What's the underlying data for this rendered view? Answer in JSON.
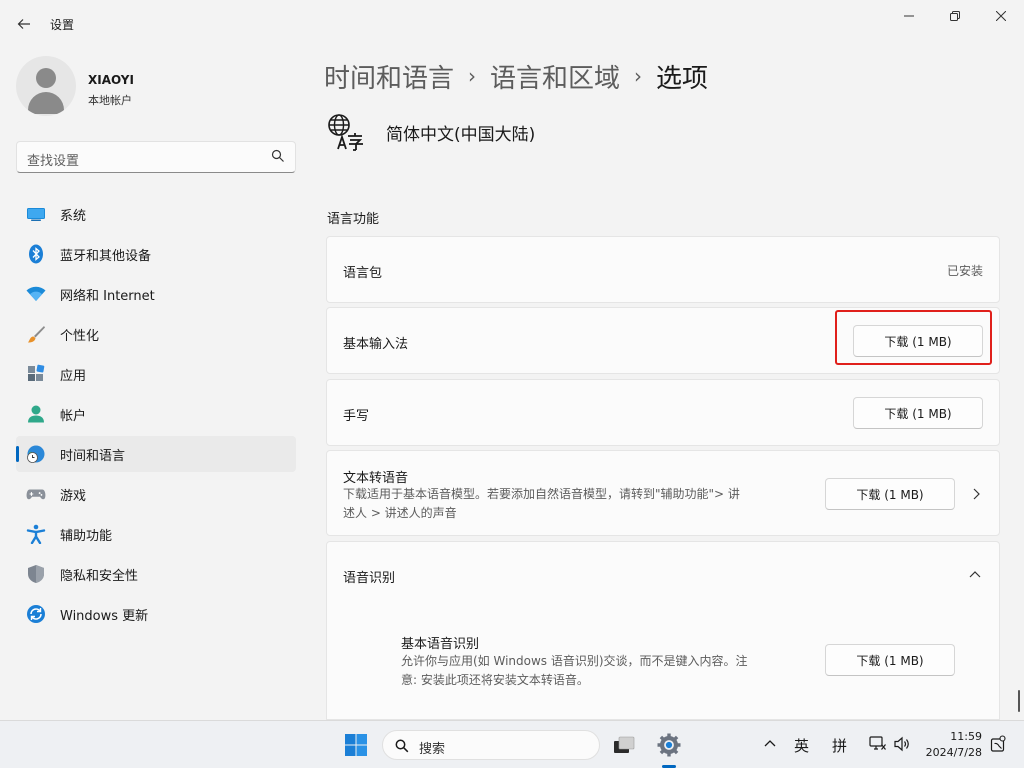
{
  "window": {
    "title": "设置",
    "controls": [
      "minimize",
      "maximize",
      "close"
    ]
  },
  "user": {
    "name": "XIAOYI",
    "account_type": "本地帐户"
  },
  "search": {
    "placeholder": "查找设置"
  },
  "sidebar": {
    "items": [
      {
        "label": "系统",
        "icon": "system-icon",
        "active": false
      },
      {
        "label": "蓝牙和其他设备",
        "icon": "bluetooth-icon",
        "active": false
      },
      {
        "label": "网络和 Internet",
        "icon": "wifi-icon",
        "active": false
      },
      {
        "label": "个性化",
        "icon": "brush-icon",
        "active": false
      },
      {
        "label": "应用",
        "icon": "apps-icon",
        "active": false
      },
      {
        "label": "帐户",
        "icon": "person-icon",
        "active": false
      },
      {
        "label": "时间和语言",
        "icon": "globe-clock-icon",
        "active": true
      },
      {
        "label": "游戏",
        "icon": "gamepad-icon",
        "active": false
      },
      {
        "label": "辅助功能",
        "icon": "accessibility-icon",
        "active": false
      },
      {
        "label": "隐私和安全性",
        "icon": "shield-icon",
        "active": false
      },
      {
        "label": "Windows 更新",
        "icon": "update-icon",
        "active": false
      }
    ]
  },
  "breadcrumb": {
    "items": [
      "时间和语言",
      "语言和区域"
    ],
    "current": "选项",
    "separator": "›"
  },
  "language": {
    "name": "简体中文(中国大陆)",
    "icon": "language-icon"
  },
  "features": {
    "section_title": "语言功能",
    "language_pack": {
      "label": "语言包",
      "status": "已安装"
    },
    "basic_typing": {
      "label": "基本输入法",
      "button": "下载 (1 MB)"
    },
    "handwriting": {
      "label": "手写",
      "button": "下载 (1 MB)"
    },
    "tts": {
      "label": "文本转语音",
      "desc_line1": "下载适用于基本语音模型。若要添加自然语音模型，请转到\"辅助功能\"> 讲",
      "desc_line2": "述人 > 讲述人的声音",
      "button": "下载 (1 MB)"
    },
    "speech": {
      "label": "语音识别",
      "basic": {
        "label": "基本语音识别",
        "desc_line1": "允许你与应用(如 Windows 语音识别)交谈，而不是键入内容。注",
        "desc_line2": "意: 安装此项还将安装文本转语音。",
        "button": "下载 (1 MB)"
      }
    }
  },
  "highlight_color": "#e0201b",
  "accent_color": "#0067c0",
  "taskbar": {
    "search_placeholder": "搜索",
    "ime_lang": "英",
    "ime_mode": "拼",
    "time": "11:59",
    "date": "2024/7/28"
  }
}
